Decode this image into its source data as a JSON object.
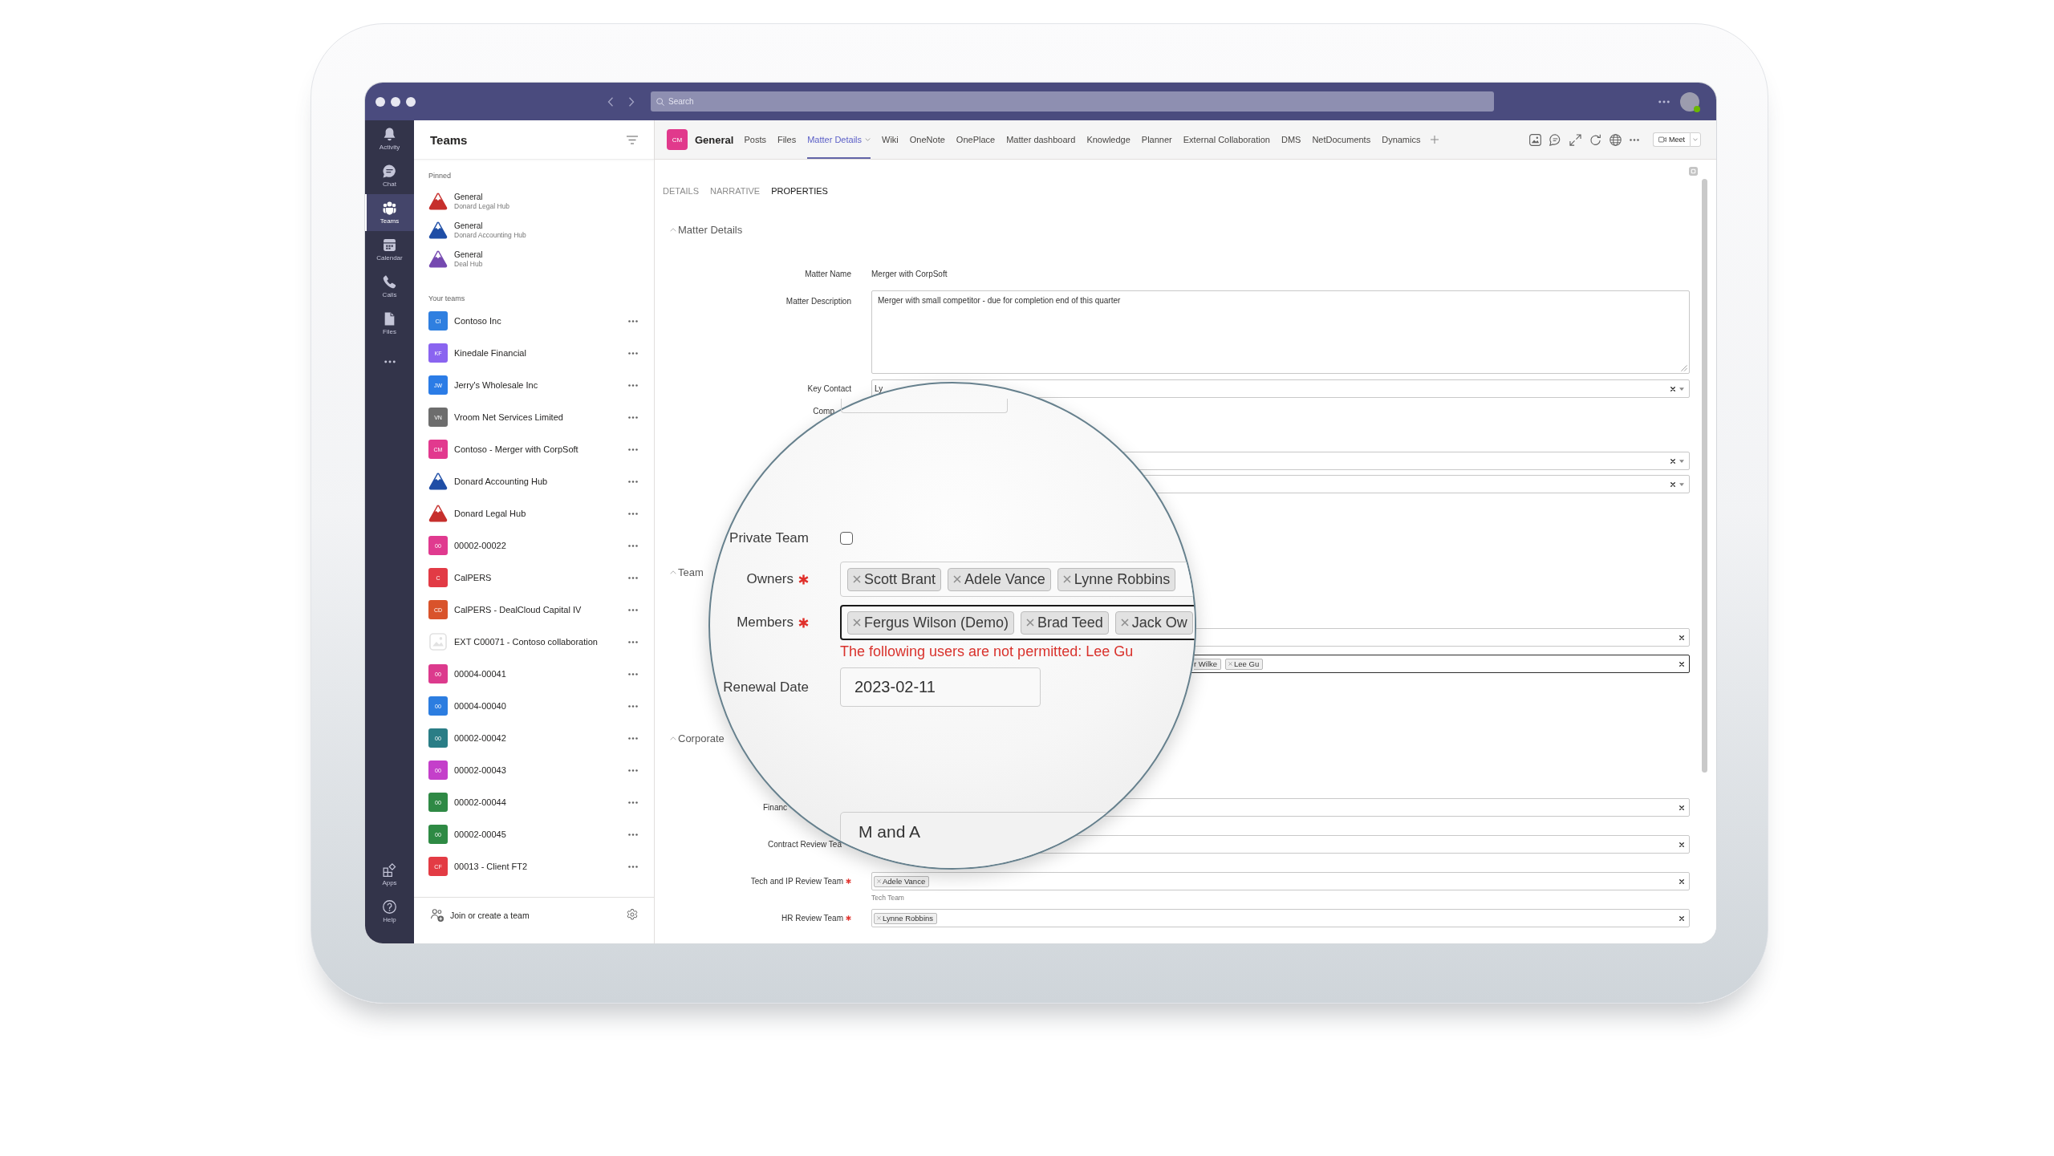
{
  "window": {
    "search": {
      "placeholder": "Search"
    }
  },
  "rail": {
    "items": [
      {
        "label": "Activity",
        "selected": false
      },
      {
        "label": "Chat",
        "selected": false
      },
      {
        "label": "Teams",
        "selected": true
      },
      {
        "label": "Calendar",
        "selected": false
      },
      {
        "label": "Calls",
        "selected": false
      },
      {
        "label": "Files",
        "selected": false
      }
    ],
    "bottom": [
      {
        "label": "Apps",
        "selected": false
      },
      {
        "label": "Help",
        "selected": false
      }
    ]
  },
  "teams_panel": {
    "title": "Teams",
    "pinned_label": "Pinned",
    "pinned": [
      {
        "name": "General",
        "team": "Donard Legal Hub",
        "color": "#c62f2c"
      },
      {
        "name": "General",
        "team": "Donard Accounting Hub",
        "color": "#1f4ea6"
      },
      {
        "name": "General",
        "team": "Deal Hub",
        "color": "#7549b0"
      }
    ],
    "your_teams_label": "Your teams",
    "teams": [
      {
        "name": "Contoso Inc",
        "kind": "initials",
        "initials": "CI",
        "color": "#2f7fe0"
      },
      {
        "name": "Kinedale Financial",
        "kind": "initials",
        "initials": "KF",
        "color": "#8a64f0"
      },
      {
        "name": "Jerry's Wholesale Inc",
        "kind": "initials",
        "initials": "JW",
        "color": "#2b7ce6"
      },
      {
        "name": "Vroom Net Services Limited",
        "kind": "initials",
        "initials": "VN",
        "color": "#6d6d6d"
      },
      {
        "name": "Contoso - Merger with CorpSoft",
        "kind": "initials",
        "initials": "CM",
        "color": "#e2398e"
      },
      {
        "name": "Donard Accounting Hub",
        "kind": "mountain",
        "color": "#1f4ea6"
      },
      {
        "name": "Donard Legal Hub",
        "kind": "mountain",
        "color": "#c62f2c"
      },
      {
        "name": "00002-00022",
        "kind": "initials",
        "initials": "00",
        "color": "#e03a8f"
      },
      {
        "name": "CalPERS",
        "kind": "initials",
        "initials": "C",
        "color": "#e23a45"
      },
      {
        "name": "CalPERS - DealCloud Capital IV",
        "kind": "initials",
        "initials": "CD",
        "color": "#d9532b"
      },
      {
        "name": "EXT C00071 - Contoso collaboration",
        "kind": "image"
      },
      {
        "name": "00004-00041",
        "kind": "initials",
        "initials": "00",
        "color": "#dc3a8d"
      },
      {
        "name": "00004-00040",
        "kind": "initials",
        "initials": "00",
        "color": "#2c7de0"
      },
      {
        "name": "00002-00042",
        "kind": "initials",
        "initials": "00",
        "color": "#2a7d86"
      },
      {
        "name": "00002-00043",
        "kind": "initials",
        "initials": "00",
        "color": "#c43fca"
      },
      {
        "name": "00002-00044",
        "kind": "initials",
        "initials": "00",
        "color": "#2f8945"
      },
      {
        "name": "00002-00045",
        "kind": "initials",
        "initials": "00",
        "color": "#2e8a44"
      },
      {
        "name": "00013 - Client FT2",
        "kind": "initials",
        "initials": "CF",
        "color": "#e33b44"
      }
    ],
    "footer": "Join or create a team"
  },
  "channel": {
    "avatar": "CM",
    "title": "General",
    "tabs": [
      {
        "label": "Posts",
        "selected": false,
        "dropdown": false
      },
      {
        "label": "Files",
        "selected": false,
        "dropdown": false
      },
      {
        "label": "Matter Details",
        "selected": true,
        "dropdown": true
      },
      {
        "label": "Wiki",
        "selected": false,
        "dropdown": false
      },
      {
        "label": "OneNote",
        "selected": false,
        "dropdown": false
      },
      {
        "label": "OnePlace",
        "selected": false,
        "dropdown": false
      },
      {
        "label": "Matter dashboard",
        "selected": false,
        "dropdown": false
      },
      {
        "label": "Knowledge",
        "selected": false,
        "dropdown": false
      },
      {
        "label": "Planner",
        "selected": false,
        "dropdown": false
      },
      {
        "label": "External Collaboration",
        "selected": false,
        "dropdown": false
      },
      {
        "label": "DMS",
        "selected": false,
        "dropdown": false
      },
      {
        "label": "NetDocuments",
        "selected": false,
        "dropdown": false
      },
      {
        "label": "Dynamics",
        "selected": false,
        "dropdown": false
      }
    ],
    "meet": "Meet"
  },
  "form": {
    "subtabs": [
      {
        "label": "DETAILS",
        "selected": false
      },
      {
        "label": "NARRATIVE",
        "selected": false
      },
      {
        "label": "PROPERTIES",
        "selected": true
      }
    ],
    "sections": [
      {
        "title": "Matter Details",
        "expanded": true,
        "rows": [
          {
            "kind": "text",
            "label": "Matter Name",
            "required": false,
            "value": "Merger with CorpSoft"
          },
          {
            "kind": "textarea",
            "label": "Matter Description",
            "required": false,
            "focused": false,
            "value": "Merger with small competitor - due for completion end of this quarter"
          },
          {
            "kind": "select",
            "label": "Key Contact",
            "required": false,
            "focused": false,
            "value": "Ly"
          },
          {
            "kind": "label",
            "label": "Comp",
            "required": false
          },
          {
            "kind": "select",
            "focused": false
          },
          {
            "kind": "select",
            "focused": false
          }
        ]
      },
      {
        "title": "Team",
        "expanded": true,
        "rows": [
          {
            "kind": "tags",
            "focused": false
          },
          {
            "kind": "tags",
            "focused": true,
            "tags": [
              {
                "label": "r Wilke",
                "under_lens": true
              },
              {
                "label": "Lee Gu",
                "under_lens": false
              }
            ]
          }
        ]
      },
      {
        "title": "Corporate",
        "expanded": true,
        "rows": [
          {
            "kind": "tags",
            "label": "Financ",
            "required": false,
            "focused": false
          },
          {
            "kind": "tags",
            "label": "Contract Review Tea",
            "required": false,
            "focused": false
          },
          {
            "kind": "tags",
            "label": "Tech and IP Review Team",
            "required": true,
            "focused": false,
            "tags": [
              {
                "label": "Adele Vance",
                "under_lens": false
              }
            ],
            "hint": "Tech Team"
          },
          {
            "kind": "tags",
            "label": "HR Review Team",
            "required": true,
            "focused": false,
            "tags": [
              {
                "label": "Lynne Robbins",
                "under_lens": false
              }
            ]
          }
        ]
      }
    ]
  },
  "magnifier": {
    "rows": [
      {
        "kind": "checkbox",
        "label": "Private Team",
        "required": false,
        "checked": false
      },
      {
        "kind": "tags",
        "label": "Owners",
        "required": true,
        "focused": false,
        "tags": [
          {
            "label": "Scott Brant"
          },
          {
            "label": "Adele Vance"
          },
          {
            "label": "Lynne Robbins"
          }
        ]
      },
      {
        "kind": "tags",
        "label": "Members",
        "required": true,
        "focused": true,
        "tags": [
          {
            "label": "Fergus Wilson (Demo)"
          },
          {
            "label": "Brad Teed"
          },
          {
            "label": "Jack Ow"
          }
        ],
        "error": "The following users are not permitted: Lee Gu"
      },
      {
        "kind": "date",
        "label": "Renewal Date",
        "required": false,
        "value": "2023-02-11"
      },
      {
        "kind": "text",
        "value": "M and A"
      }
    ]
  }
}
